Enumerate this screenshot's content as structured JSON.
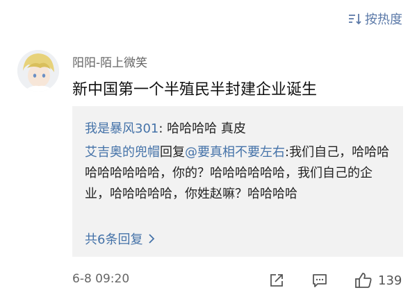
{
  "sort": {
    "label": "按热度"
  },
  "comment": {
    "username": "阳阳-陌上微笑",
    "text": "新中国第一个半殖民半封建企业诞生",
    "time": "6-8 09:20",
    "likes": "139"
  },
  "replies": [
    {
      "user": "我是暴风301",
      "sep": ": ",
      "text": "哈哈哈哈 真皮"
    },
    {
      "user": "艾吉奥的兜帽",
      "action": "回复",
      "target": "@要真相不要左右",
      "sep": ":",
      "text": "我们自己，哈哈哈哈哈哈哈哈哈，你的？哈哈哈哈哈哈，我们自己的企业，哈哈哈哈哈，你姓赵嘛？哈哈哈哈"
    }
  ],
  "more_replies": "共6条回复",
  "icons": [
    "sort-icon",
    "avatar",
    "chevron-right-icon",
    "share-icon",
    "comment-icon",
    "thumbs-up-icon"
  ],
  "colors": {
    "link": "#4472a8",
    "reply_bg": "#f2f2f2"
  }
}
